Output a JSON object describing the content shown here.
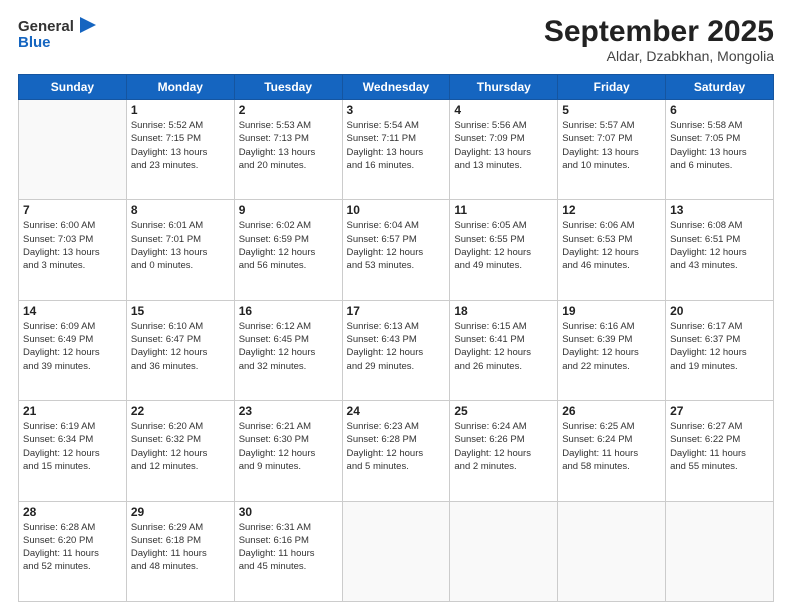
{
  "logo": {
    "line1": "General",
    "line2": "Blue"
  },
  "title": "September 2025",
  "subtitle": "Aldar, Dzabkhan, Mongolia",
  "days_of_week": [
    "Sunday",
    "Monday",
    "Tuesday",
    "Wednesday",
    "Thursday",
    "Friday",
    "Saturday"
  ],
  "weeks": [
    [
      {
        "day": "",
        "info": ""
      },
      {
        "day": "1",
        "info": "Sunrise: 5:52 AM\nSunset: 7:15 PM\nDaylight: 13 hours\nand 23 minutes."
      },
      {
        "day": "2",
        "info": "Sunrise: 5:53 AM\nSunset: 7:13 PM\nDaylight: 13 hours\nand 20 minutes."
      },
      {
        "day": "3",
        "info": "Sunrise: 5:54 AM\nSunset: 7:11 PM\nDaylight: 13 hours\nand 16 minutes."
      },
      {
        "day": "4",
        "info": "Sunrise: 5:56 AM\nSunset: 7:09 PM\nDaylight: 13 hours\nand 13 minutes."
      },
      {
        "day": "5",
        "info": "Sunrise: 5:57 AM\nSunset: 7:07 PM\nDaylight: 13 hours\nand 10 minutes."
      },
      {
        "day": "6",
        "info": "Sunrise: 5:58 AM\nSunset: 7:05 PM\nDaylight: 13 hours\nand 6 minutes."
      }
    ],
    [
      {
        "day": "7",
        "info": "Sunrise: 6:00 AM\nSunset: 7:03 PM\nDaylight: 13 hours\nand 3 minutes."
      },
      {
        "day": "8",
        "info": "Sunrise: 6:01 AM\nSunset: 7:01 PM\nDaylight: 13 hours\nand 0 minutes."
      },
      {
        "day": "9",
        "info": "Sunrise: 6:02 AM\nSunset: 6:59 PM\nDaylight: 12 hours\nand 56 minutes."
      },
      {
        "day": "10",
        "info": "Sunrise: 6:04 AM\nSunset: 6:57 PM\nDaylight: 12 hours\nand 53 minutes."
      },
      {
        "day": "11",
        "info": "Sunrise: 6:05 AM\nSunset: 6:55 PM\nDaylight: 12 hours\nand 49 minutes."
      },
      {
        "day": "12",
        "info": "Sunrise: 6:06 AM\nSunset: 6:53 PM\nDaylight: 12 hours\nand 46 minutes."
      },
      {
        "day": "13",
        "info": "Sunrise: 6:08 AM\nSunset: 6:51 PM\nDaylight: 12 hours\nand 43 minutes."
      }
    ],
    [
      {
        "day": "14",
        "info": "Sunrise: 6:09 AM\nSunset: 6:49 PM\nDaylight: 12 hours\nand 39 minutes."
      },
      {
        "day": "15",
        "info": "Sunrise: 6:10 AM\nSunset: 6:47 PM\nDaylight: 12 hours\nand 36 minutes."
      },
      {
        "day": "16",
        "info": "Sunrise: 6:12 AM\nSunset: 6:45 PM\nDaylight: 12 hours\nand 32 minutes."
      },
      {
        "day": "17",
        "info": "Sunrise: 6:13 AM\nSunset: 6:43 PM\nDaylight: 12 hours\nand 29 minutes."
      },
      {
        "day": "18",
        "info": "Sunrise: 6:15 AM\nSunset: 6:41 PM\nDaylight: 12 hours\nand 26 minutes."
      },
      {
        "day": "19",
        "info": "Sunrise: 6:16 AM\nSunset: 6:39 PM\nDaylight: 12 hours\nand 22 minutes."
      },
      {
        "day": "20",
        "info": "Sunrise: 6:17 AM\nSunset: 6:37 PM\nDaylight: 12 hours\nand 19 minutes."
      }
    ],
    [
      {
        "day": "21",
        "info": "Sunrise: 6:19 AM\nSunset: 6:34 PM\nDaylight: 12 hours\nand 15 minutes."
      },
      {
        "day": "22",
        "info": "Sunrise: 6:20 AM\nSunset: 6:32 PM\nDaylight: 12 hours\nand 12 minutes."
      },
      {
        "day": "23",
        "info": "Sunrise: 6:21 AM\nSunset: 6:30 PM\nDaylight: 12 hours\nand 9 minutes."
      },
      {
        "day": "24",
        "info": "Sunrise: 6:23 AM\nSunset: 6:28 PM\nDaylight: 12 hours\nand 5 minutes."
      },
      {
        "day": "25",
        "info": "Sunrise: 6:24 AM\nSunset: 6:26 PM\nDaylight: 12 hours\nand 2 minutes."
      },
      {
        "day": "26",
        "info": "Sunrise: 6:25 AM\nSunset: 6:24 PM\nDaylight: 11 hours\nand 58 minutes."
      },
      {
        "day": "27",
        "info": "Sunrise: 6:27 AM\nSunset: 6:22 PM\nDaylight: 11 hours\nand 55 minutes."
      }
    ],
    [
      {
        "day": "28",
        "info": "Sunrise: 6:28 AM\nSunset: 6:20 PM\nDaylight: 11 hours\nand 52 minutes."
      },
      {
        "day": "29",
        "info": "Sunrise: 6:29 AM\nSunset: 6:18 PM\nDaylight: 11 hours\nand 48 minutes."
      },
      {
        "day": "30",
        "info": "Sunrise: 6:31 AM\nSunset: 6:16 PM\nDaylight: 11 hours\nand 45 minutes."
      },
      {
        "day": "",
        "info": ""
      },
      {
        "day": "",
        "info": ""
      },
      {
        "day": "",
        "info": ""
      },
      {
        "day": "",
        "info": ""
      }
    ]
  ]
}
